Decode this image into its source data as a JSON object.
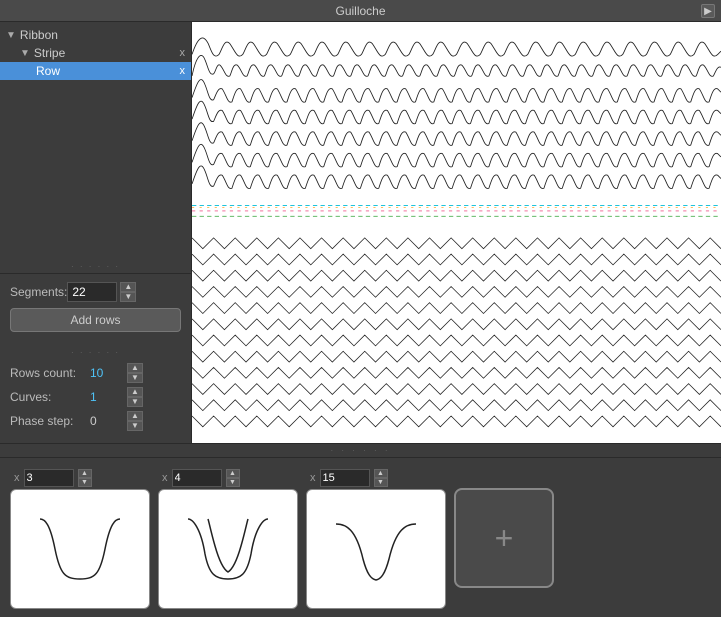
{
  "titleBar": {
    "title": "Guilloche",
    "exportBtn": "▶"
  },
  "tree": {
    "ribbon": {
      "label": "Ribbon",
      "arrow": "▼"
    },
    "stripe": {
      "label": "Stripe",
      "arrow": "▼",
      "closeBtn": "x"
    },
    "row": {
      "label": "Row",
      "closeBtn": "x"
    }
  },
  "controls": {
    "segmentsLabel": "Segments:",
    "segmentsValue": "22",
    "addRowsBtn": "Add rows"
  },
  "params": {
    "rowsCountLabel": "Rows count:",
    "rowsCountValue": "10",
    "curvesLabel": "Curves:",
    "curvesValue": "1",
    "phaseStepLabel": "Phase step:",
    "phaseStepValue": "0"
  },
  "curves": [
    {
      "xLabel": "x",
      "value": "3",
      "svgType": "v-shape"
    },
    {
      "xLabel": "x",
      "value": "4",
      "svgType": "w-shape"
    },
    {
      "xLabel": "x",
      "value": "15",
      "svgType": "v-wide"
    }
  ],
  "addCurveBtn": "+",
  "colors": {
    "selected": "#4a90d9",
    "accent": "#3c3c3c",
    "panelBg": "#3c3c3c"
  }
}
